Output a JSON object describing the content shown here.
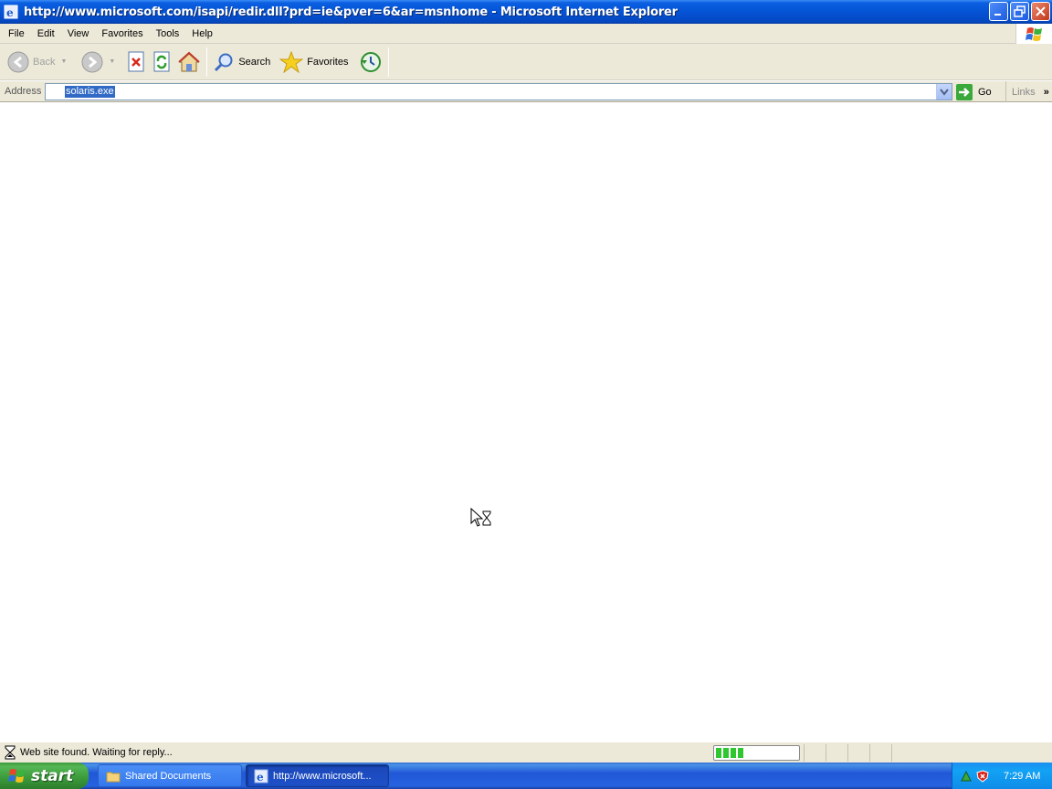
{
  "window": {
    "title": "http://www.microsoft.com/isapi/redir.dll?prd=ie&pver=6&ar=msnhome - Microsoft Internet Explorer"
  },
  "menu": {
    "items": [
      "File",
      "Edit",
      "View",
      "Favorites",
      "Tools",
      "Help"
    ]
  },
  "toolbar": {
    "back_label": "Back",
    "search_label": "Search",
    "favorites_label": "Favorites"
  },
  "address": {
    "label": "Address",
    "value": "solaris.exe",
    "go_label": "Go",
    "links_label": "Links",
    "links_chevron": "»"
  },
  "status": {
    "text": "Web site found. Waiting for reply...",
    "progress": 0.35
  },
  "taskbar": {
    "start_label": "start",
    "tasks": [
      {
        "label": "Shared Documents",
        "icon": "folder-icon"
      },
      {
        "label": "http://www.microsoft...",
        "icon": "ie-icon"
      }
    ],
    "clock": "7:29 AM"
  },
  "colors": {
    "titlebar": "#0553d6",
    "chrome": "#ece9d8",
    "taskbar": "#2157d7",
    "start": "#3a9a3a",
    "selection": "#316ac5"
  }
}
